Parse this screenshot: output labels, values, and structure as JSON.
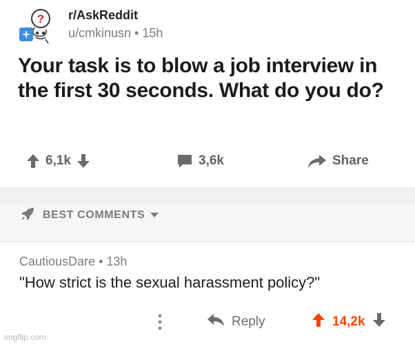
{
  "post": {
    "subreddit": "r/AskReddit",
    "author": "u/cmkinusn",
    "separator": "•",
    "age": "15h",
    "title": "Your task is to blow a job interview in the first 30 seconds. What do you do?",
    "score": "6,1k",
    "comments": "3,6k",
    "share_label": "Share",
    "icons": {
      "avatar": "askreddit-question-avatar-icon",
      "add": "plus-badge-icon",
      "upvote": "arrow-up-icon",
      "downvote": "arrow-down-icon",
      "comments": "comment-bubble-icon",
      "share": "share-arrow-icon"
    }
  },
  "sort_bar": {
    "label": "BEST COMMENTS",
    "icons": {
      "sort": "rocket-icon",
      "dropdown": "caret-down-icon"
    }
  },
  "comment": {
    "author": "CautiousDare",
    "separator": "•",
    "age": "13h",
    "body": "\"How strict is the sexual harassment policy?\"",
    "reply_label": "Reply",
    "score": "14,2k",
    "icons": {
      "more": "vertical-dots-icon",
      "reply": "reply-arrow-icon",
      "upvote": "arrow-up-icon",
      "downvote": "arrow-down-icon"
    }
  },
  "watermark": "imgflip.com",
  "colors": {
    "upvoted": "#ff4500",
    "muted_text": "#7c7c7c",
    "band": "#f0f0f0",
    "add_badge": "#3d8fe0"
  }
}
